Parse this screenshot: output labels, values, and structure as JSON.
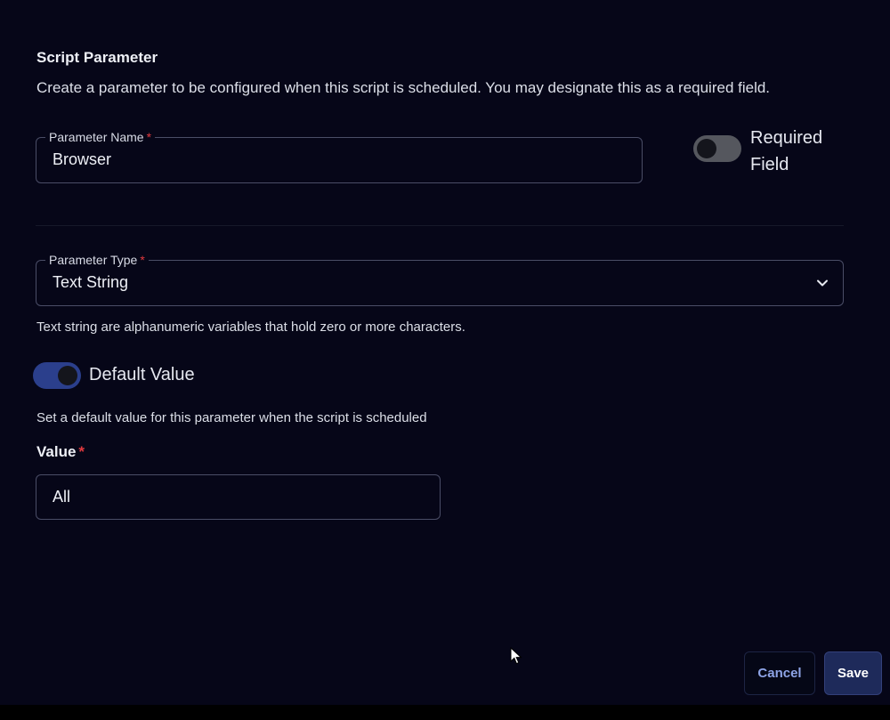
{
  "section": {
    "title": "Script Parameter",
    "description": "Create a parameter to be configured when this script is scheduled. You may designate this as a required field."
  },
  "parameter_name": {
    "label": "Parameter Name",
    "required_marker": "*",
    "value": "Browser"
  },
  "required_field": {
    "label_line1": "Required",
    "label_line2": "Field",
    "enabled": false
  },
  "parameter_type": {
    "label": "Parameter Type",
    "required_marker": "*",
    "selected": "Text String",
    "help": "Text string are alphanumeric variables that hold zero or more characters."
  },
  "default_value": {
    "toggle_label": "Default Value",
    "enabled": true,
    "help": "Set a default value for this parameter when the script is scheduled"
  },
  "value_field": {
    "label": "Value",
    "required_marker": "*",
    "value": "All"
  },
  "actions": {
    "cancel_label": "Cancel",
    "save_label": "Save"
  },
  "icons": {
    "dropdown": "chevron-down-icon",
    "pointer": "mouse-cursor-icon"
  },
  "colors": {
    "background": "#060618",
    "field_border": "#4a4d66",
    "required_star": "#e0393e",
    "toggle_on": "#2b3f8c",
    "toggle_off": "#55575e",
    "cancel_text": "#8ea4e6",
    "save_bg": "#1e2a5a"
  }
}
